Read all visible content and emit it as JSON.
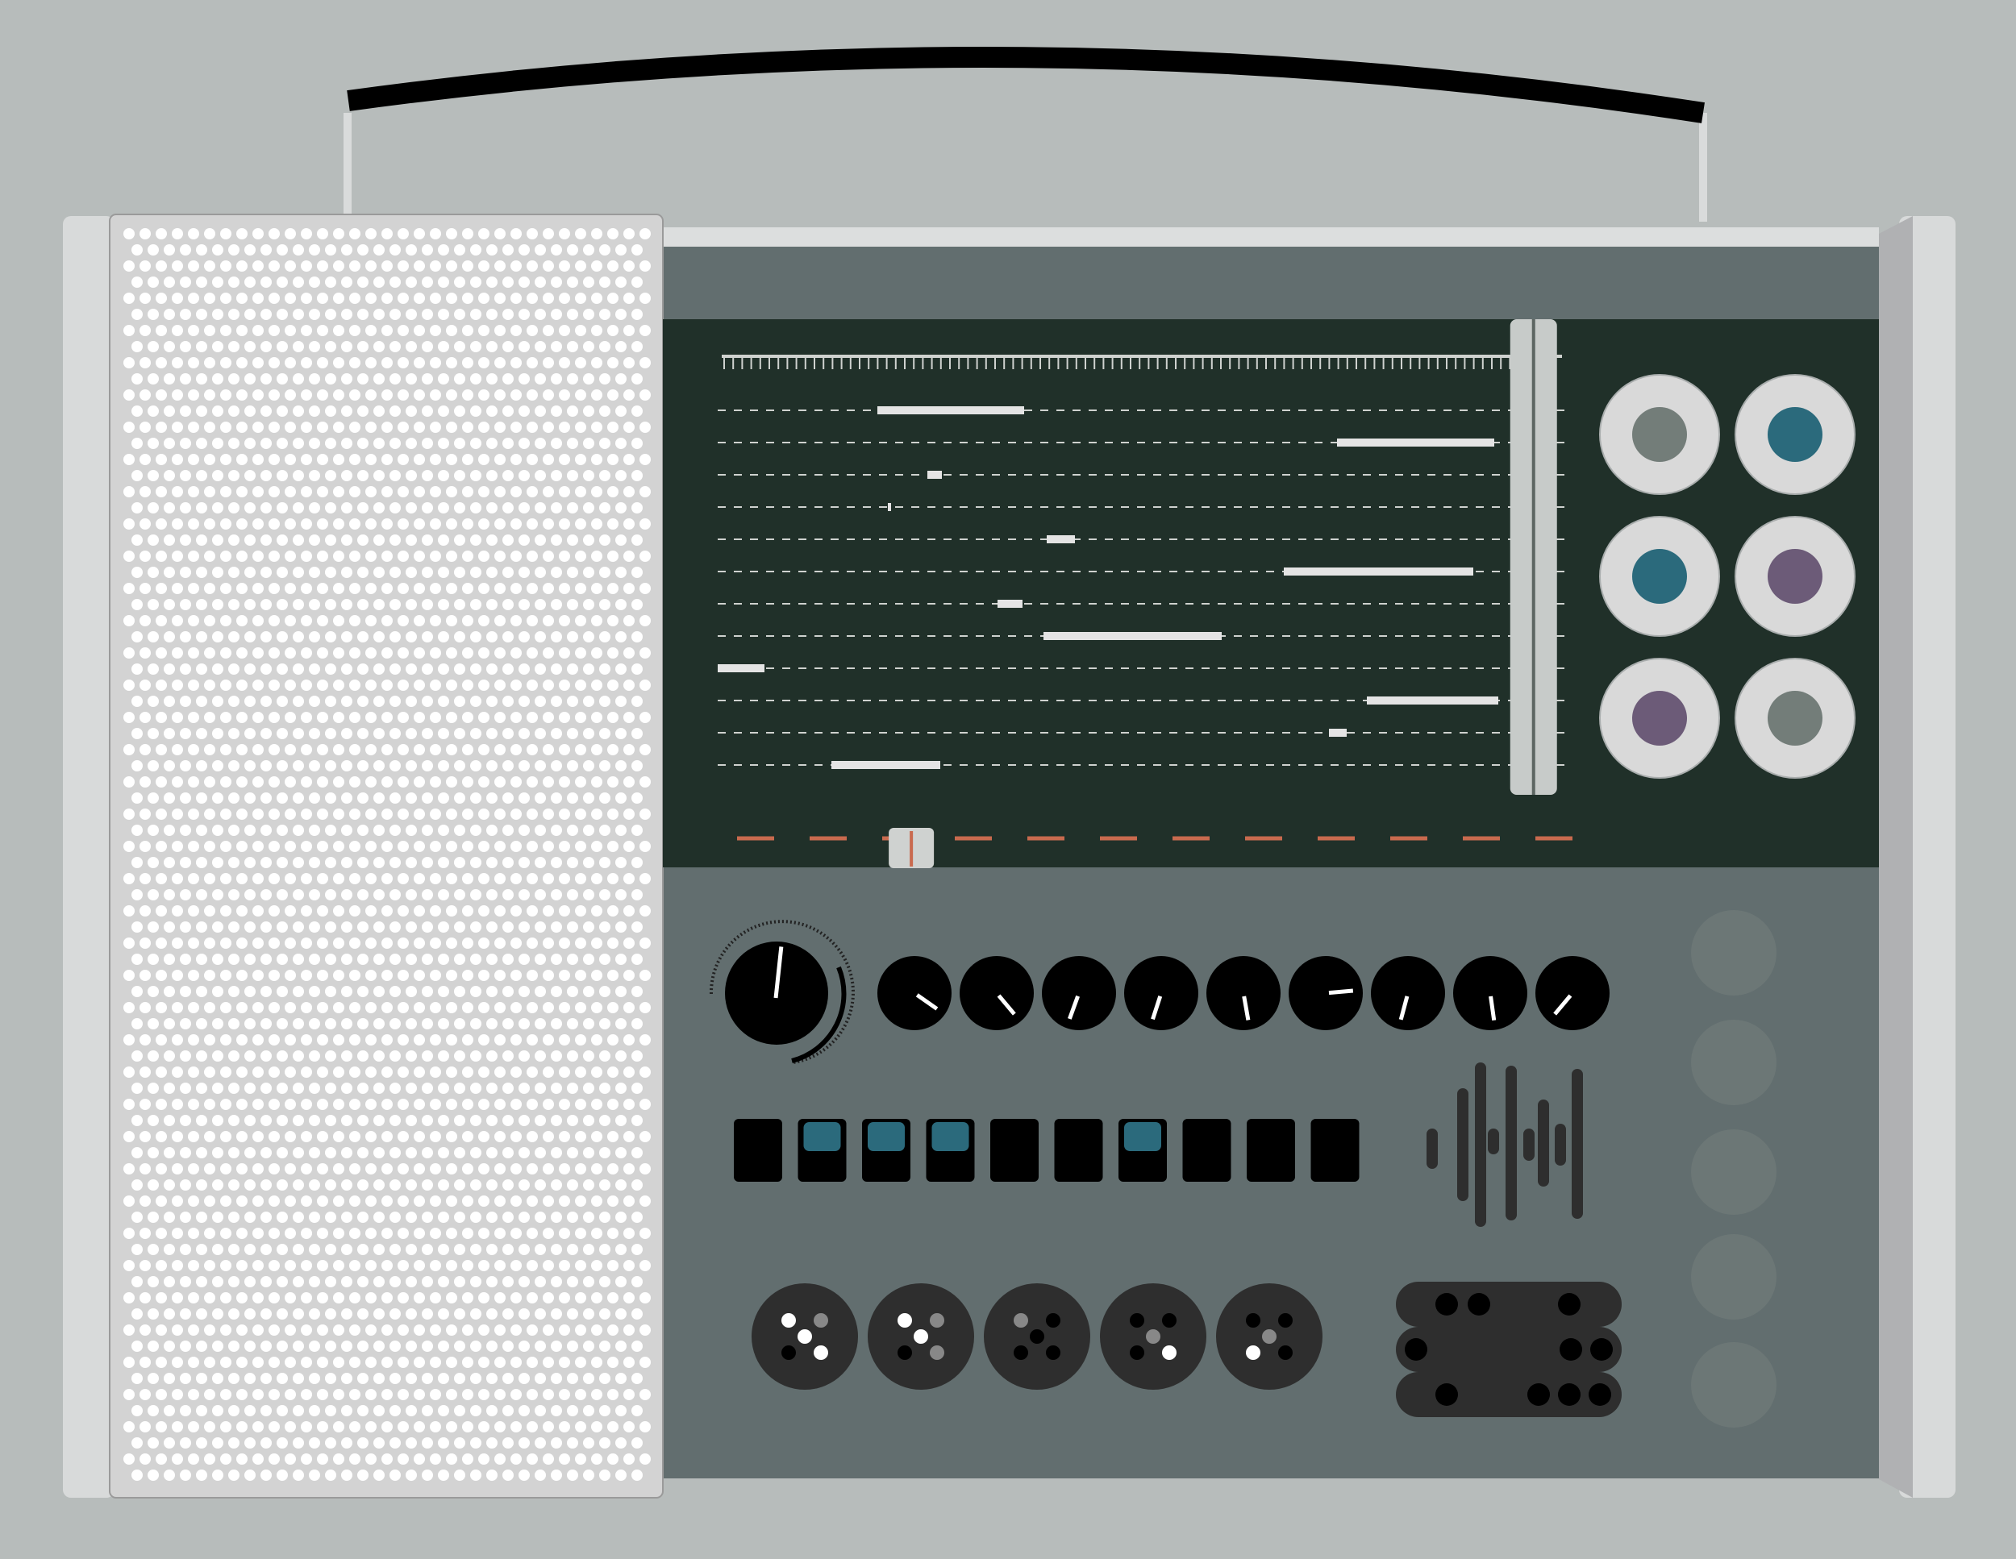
{
  "colors": {
    "background": "#b7bcbb",
    "speaker_grille": "#d3d3d3",
    "grille_holes": "#ffffff",
    "body_metal": "#d6d8d8",
    "panel": "#626e6f",
    "display": "#203029",
    "display_marks": "#e4e4e4",
    "dial_pointer": "#c96a4e",
    "knob": "#000000",
    "button": "#000000",
    "button_lit": "#2b6a7c",
    "jack_body": "#2e2e2e",
    "jack_plate": "#2e2e2e",
    "pads": "#6c7776"
  },
  "icons": {
    "handle": "carry-handle-icon",
    "speaker": "speaker-grille-icon",
    "big_knob": "volume-knob-icon",
    "knob": "rotary-knob-icon",
    "jack": "din-socket-icon",
    "level_meter": "level-meter-icon",
    "plate": "connector-plate-icon"
  },
  "display": {
    "tuner_position": 0.718,
    "dial_pointer_position": 0.225,
    "rows": 12
  },
  "knobs": {
    "main_angle": 7,
    "angles": [
      -55,
      -40,
      20,
      18,
      -10,
      -95,
      15,
      -8,
      40
    ]
  },
  "buttons": {
    "lit": [
      false,
      true,
      true,
      true,
      false,
      false,
      true,
      false,
      false,
      false
    ]
  },
  "selectors": [
    {
      "ring_color": "#d9d9d9",
      "dot_color": "#737d79"
    },
    {
      "ring_color": "#d9d9d9",
      "dot_color": "#2b6a7c"
    },
    {
      "ring_color": "#d9d9d9",
      "dot_color": "#2b6a7c"
    },
    {
      "ring_color": "#d9d9d9",
      "dot_color": "#6c5b78"
    },
    {
      "ring_color": "#d9d9d9",
      "dot_color": "#6c5b78"
    },
    {
      "ring_color": "#d9d9d9",
      "dot_color": "#737d79"
    }
  ]
}
